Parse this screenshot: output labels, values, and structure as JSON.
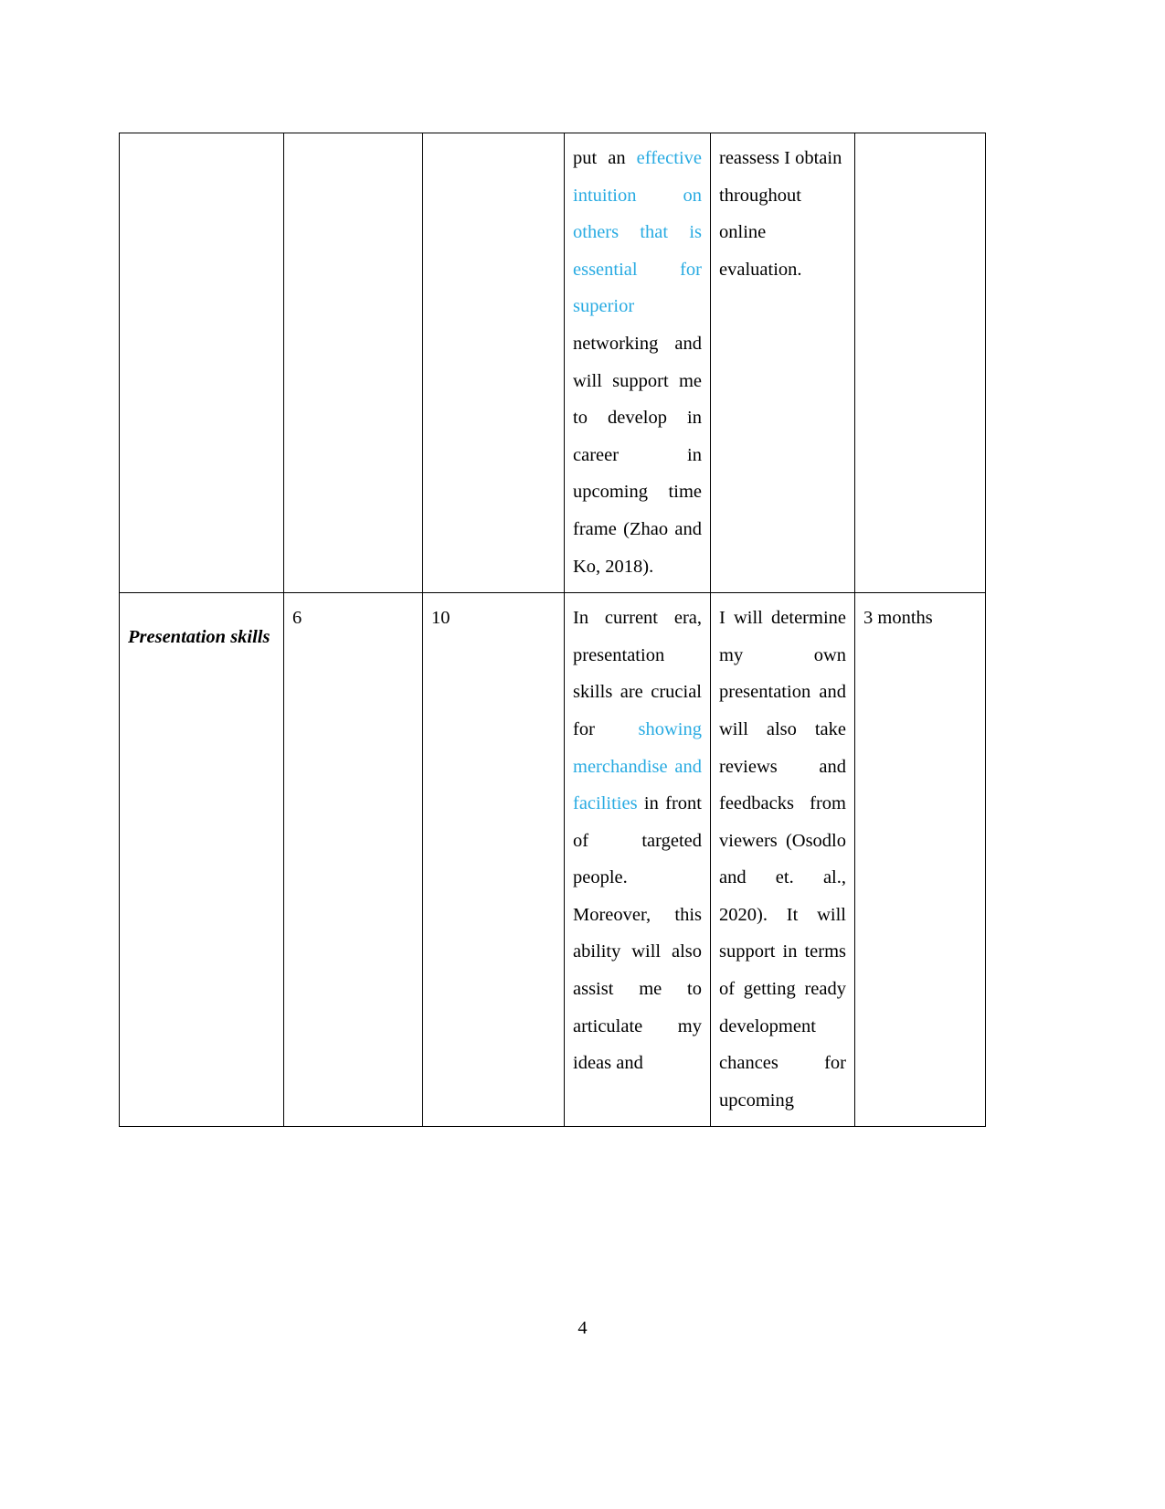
{
  "document": {
    "page_number": "4",
    "highlight_color": "#29ABE2",
    "table": {
      "columns": [
        "skill",
        "current_rating",
        "target_rating",
        "development_opportunities",
        "criteria_for_judging_success",
        "time_frame"
      ],
      "rows": [
        {
          "type": "continuation",
          "skill": "",
          "current_rating": "",
          "target_rating": "",
          "development_opportunities": {
            "segments": [
              {
                "text": "put an ",
                "highlight": false
              },
              {
                "text": "effective intuition on others that is essential for superior ",
                "highlight": true
              },
              {
                "text": "networking and will support me to develop in career in upcoming time frame (Zhao and Ko, 2018).",
                "highlight": false
              }
            ],
            "plain_text": "put an effective intuition on others that is essential for superior networking and will support me to develop in career in upcoming time frame (Zhao and Ko, 2018)."
          },
          "criteria_for_judging_success": {
            "segments": [
              {
                "text": "reassess I obtain throughout online evaluation.",
                "highlight": false
              }
            ],
            "plain_text": "reassess I obtain throughout online evaluation."
          },
          "time_frame": ""
        },
        {
          "type": "normal",
          "skill": "Presentation skills",
          "current_rating": "6",
          "target_rating": "10",
          "development_opportunities": {
            "segments": [
              {
                "text": "In current era, presentation skills are crucial for ",
                "highlight": false
              },
              {
                "text": "showing merchandise and facilities ",
                "highlight": true
              },
              {
                "text": "in front of targeted people. Moreover, this ability will also assist me to articulate my ideas and",
                "highlight": false
              }
            ],
            "plain_text": "In current era, presentation skills are crucial for showing merchandise and facilities in front of targeted people. Moreover, this ability will also assist me to articulate my ideas and"
          },
          "criteria_for_judging_success": {
            "segments": [
              {
                "text": "I will determine my own presentation and will also take reviews and feedbacks from viewers (Osodlo and et. al., 2020). It will support in terms of getting ready development chances for upcoming",
                "highlight": false
              }
            ],
            "plain_text": "I will determine my own presentation and will also take reviews and feedbacks from viewers (Osodlo and et. al., 2020). It will support in terms of getting ready development chances for upcoming"
          },
          "time_frame": "3 months"
        }
      ]
    }
  }
}
